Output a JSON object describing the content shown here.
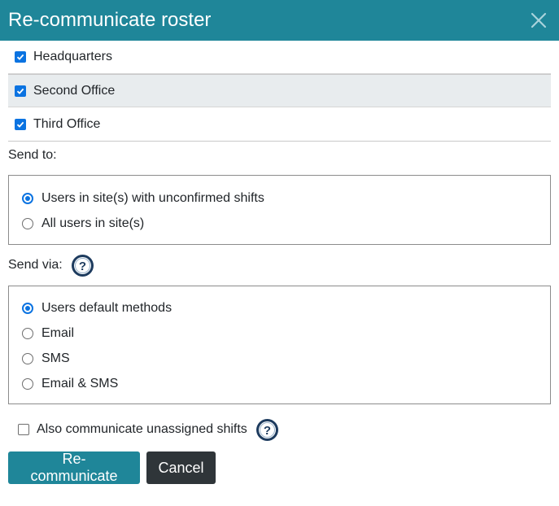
{
  "dialog": {
    "title": "Re-communicate roster",
    "close_icon": "close-icon"
  },
  "sites": [
    {
      "label": "Headquarters",
      "checked": true
    },
    {
      "label": "Second Office",
      "checked": true
    },
    {
      "label": "Third Office",
      "checked": true
    }
  ],
  "send_to": {
    "label": "Send to:",
    "options": [
      {
        "label": "Users in site(s) with unconfirmed shifts",
        "selected": true
      },
      {
        "label": "All users in site(s)",
        "selected": false
      }
    ]
  },
  "send_via": {
    "label": "Send via:",
    "help_icon": "help-icon",
    "options": [
      {
        "label": "Users default methods",
        "selected": true
      },
      {
        "label": "Email",
        "selected": false
      },
      {
        "label": "SMS",
        "selected": false
      },
      {
        "label": "Email & SMS",
        "selected": false
      }
    ]
  },
  "unassigned": {
    "label": "Also communicate unassigned shifts",
    "checked": false,
    "help_icon": "help-icon"
  },
  "buttons": {
    "primary": "Re-communicate",
    "secondary": "Cancel"
  },
  "colors": {
    "accent": "#1f8699",
    "checkbox": "#0b73e1",
    "dark_button": "#2f3539"
  }
}
